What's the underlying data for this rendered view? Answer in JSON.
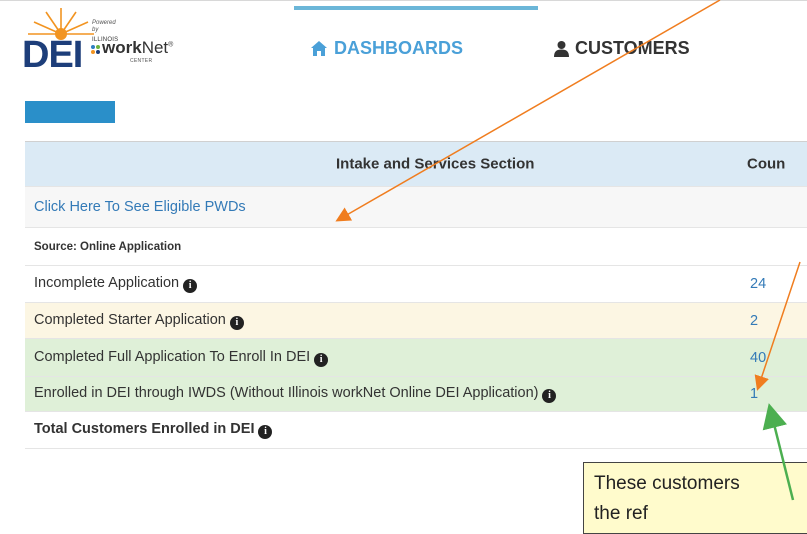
{
  "header": {
    "logo": {
      "brand": "DEI",
      "powered_by": "Powered by",
      "state": "ILLINOIS",
      "worknet_bold": "work",
      "worknet_light": "Net",
      "trademark": "®",
      "center": "CENTER"
    },
    "nav": {
      "dashboards_label": "DASHBOARDS",
      "customers_label": "CUSTOMERS"
    }
  },
  "table": {
    "columns": {
      "section": "Intake and Services Section",
      "count": "Coun"
    },
    "eligible_link": "Click Here To See Eligible PWDs",
    "source_label": "Source: Online Application",
    "rows": [
      {
        "label": "Incomplete Application",
        "count": "24"
      },
      {
        "label": "Completed Starter Application",
        "count": "2"
      },
      {
        "label": "Completed Full Application To Enroll In DEI",
        "count": "40"
      },
      {
        "label": "Enrolled in DEI through IWDS (Without Illinois workNet Online DEI Application)",
        "count": "1"
      },
      {
        "label": "Total Customers Enrolled in DEI",
        "count": ""
      }
    ]
  },
  "callout": {
    "line1": "These customers",
    "line2": "the ref"
  },
  "colors": {
    "accent": "#337ab7",
    "arrow_orange": "#f07d1f",
    "arrow_green": "#4caf50"
  }
}
